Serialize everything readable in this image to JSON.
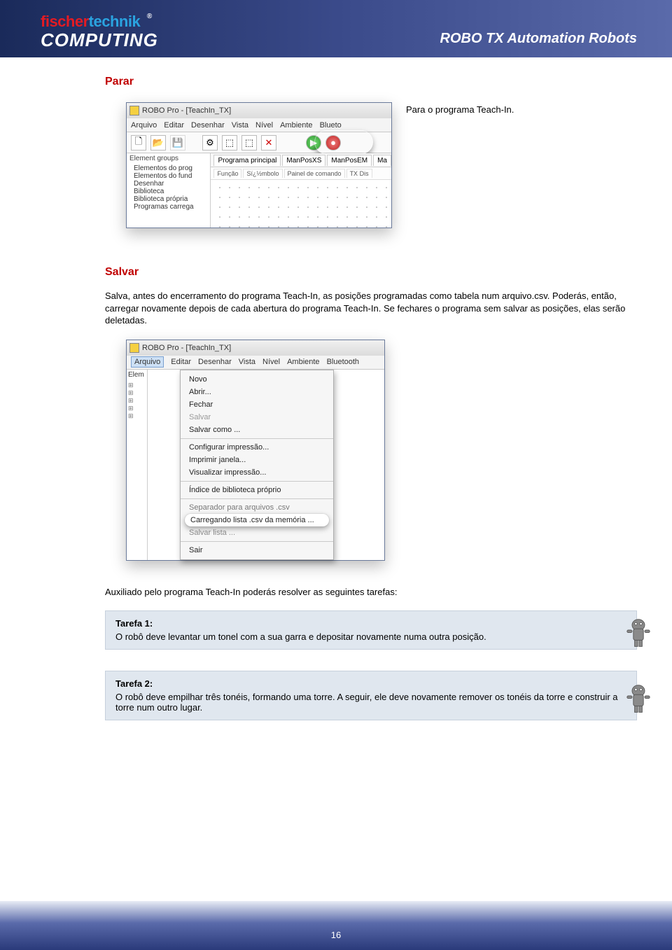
{
  "brand": {
    "part1": "fischer",
    "part2": "technik",
    "reg": "®",
    "sub": "COMPUTING"
  },
  "header_right": "ROBO TX Automation Robots",
  "section1": {
    "title": "Parar",
    "desc": "Para o programa Teach-In."
  },
  "screenshot1": {
    "title": "ROBO Pro - [TeachIn_TX]",
    "menu": [
      "Arquivo",
      "Editar",
      "Desenhar",
      "Vista",
      "Nível",
      "Ambiente",
      "Blueto"
    ],
    "tree_header": "Element groups",
    "tree": [
      "Elementos do prog",
      "Elementos do fund",
      "Desenhar",
      "Biblioteca",
      "Biblioteca própria",
      "Programas carrega"
    ],
    "tabs": [
      "Programa principal",
      "ManPosXS",
      "ManPosEM",
      "Ma"
    ],
    "subtabs": [
      "Função",
      "Sí¿½mbolo",
      "Painel de comando",
      "TX Dis"
    ],
    "tb_icons": {
      "new": "🗋",
      "open": "📂",
      "save": "💾",
      "x": "✕",
      "play": "▶",
      "stop": "●"
    }
  },
  "section2": {
    "title": "Salvar",
    "desc": "Salva, antes do encerramento do programa Teach-In, as posições programadas como tabela num arquivo.csv.  Poderás, então, carregar novamente depois de cada abertura do programa Teach-In. Se fechares o programa sem salvar as posições, elas serão deletadas."
  },
  "screenshot2": {
    "title": "ROBO Pro - [TeachIn_TX]",
    "menu": [
      "Arquivo",
      "Editar",
      "Desenhar",
      "Vista",
      "Nível",
      "Ambiente",
      "Bluetooth"
    ],
    "elem_label": "Elem",
    "menu_items": [
      {
        "label": "Novo",
        "type": "item"
      },
      {
        "label": "Abrir...",
        "type": "item"
      },
      {
        "label": "Fechar",
        "type": "item"
      },
      {
        "label": "Salvar",
        "type": "disabled"
      },
      {
        "label": "Salvar como ...",
        "type": "item"
      },
      {
        "type": "sep"
      },
      {
        "label": "Configurar impressão...",
        "type": "item"
      },
      {
        "label": "Imprimir janela...",
        "type": "item"
      },
      {
        "label": "Visualizar impressão...",
        "type": "item"
      },
      {
        "type": "sep"
      },
      {
        "label": "Índice de biblioteca próprio",
        "type": "item"
      },
      {
        "type": "sep"
      },
      {
        "label": "Separador para arquivos .csv",
        "type": "item-over"
      },
      {
        "label": "Carregando lista .csv da memória ...",
        "type": "highlight"
      },
      {
        "label": "Salvar lista ...",
        "type": "item-under"
      },
      {
        "type": "sep"
      },
      {
        "label": "Sair",
        "type": "item"
      }
    ]
  },
  "aux_text": "Auxiliado pelo programa Teach-In poderás resolver as seguintes tarefas:",
  "task1": {
    "title": "Tarefa 1:",
    "body": "O robô deve levantar um tonel com a sua garra e depositar novamente numa outra posição."
  },
  "task2": {
    "title": "Tarefa 2:",
    "body": "O robô deve empilhar três tonéis, formando uma torre. A seguir, ele deve novamente remover os tonéis da torre e construir a torre num outro lugar."
  },
  "page_number": "16"
}
